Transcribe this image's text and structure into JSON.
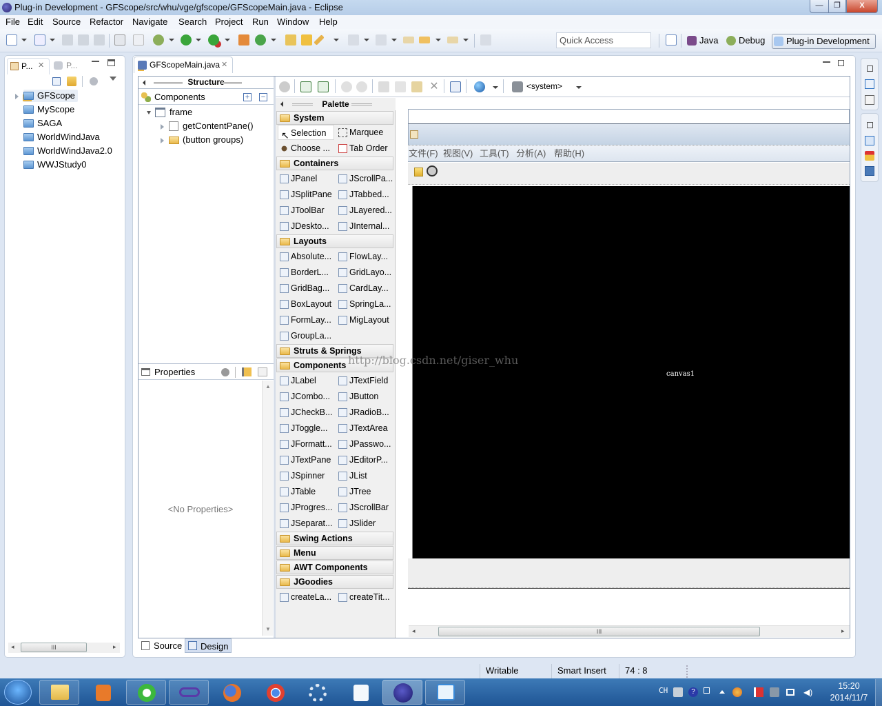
{
  "window": {
    "title": "Plug-in Development - GFScope/src/whu/vge/gfscope/GFScopeMain.java - Eclipse",
    "minimize_label": "—",
    "maximize_label": "❐",
    "close_label": "X"
  },
  "menubar": [
    "File",
    "Edit",
    "Source",
    "Refactor",
    "Navigate",
    "Search",
    "Project",
    "Run",
    "Window",
    "Help"
  ],
  "toolbar": {
    "quick_access_placeholder": "Quick Access",
    "perspectives": [
      {
        "label": "Java",
        "icon": "java-perspective-icon"
      },
      {
        "label": "Debug",
        "icon": "debug-perspective-icon"
      },
      {
        "label": "Plug-in Development",
        "icon": "plugin-perspective-icon",
        "active": true
      }
    ]
  },
  "left_panel": {
    "tabs": [
      {
        "label": "P...",
        "icon": "package-explorer-icon",
        "active": true
      },
      {
        "label": "P...",
        "icon": "plugins-icon",
        "active": false
      }
    ],
    "projects": [
      {
        "label": "GFScope",
        "selected": true
      },
      {
        "label": "MyScope"
      },
      {
        "label": "SAGA"
      },
      {
        "label": "WorldWindJava"
      },
      {
        "label": "WorldWindJava2.0"
      },
      {
        "label": "WWJStudy0"
      }
    ],
    "hscroll_thumb": "III"
  },
  "editor": {
    "tab_label": "GFScopeMain.java",
    "structure": {
      "title": "Structure",
      "components_label": "Components",
      "tree": {
        "root": "frame",
        "children": [
          "getContentPane()",
          "(button groups)"
        ]
      }
    },
    "properties": {
      "title": "Properties",
      "empty_text": "<No Properties>"
    },
    "design_toolbar": {
      "lookandfeel_label": "<system>"
    },
    "palette": {
      "title": "Palette",
      "categories": [
        {
          "name": "System",
          "open": true,
          "items": [
            "Selection",
            "Marquee",
            "Choose ...",
            "Tab Order"
          ]
        },
        {
          "name": "Containers",
          "open": false,
          "items": [
            "JPanel",
            "JScrollPa...",
            "JSplitPane",
            "JTabbed...",
            "JToolBar",
            "JLayered...",
            "JDeskto...",
            "JInternal..."
          ]
        },
        {
          "name": "Layouts",
          "open": true,
          "items": [
            "Absolute...",
            "FlowLay...",
            "BorderL...",
            "GridLayo...",
            "GridBag...",
            "CardLay...",
            "BoxLayout",
            "SpringLa...",
            "FormLay...",
            "MigLayout",
            "GroupLa..."
          ]
        },
        {
          "name": "Struts & Springs",
          "open": false,
          "items": []
        },
        {
          "name": "Components",
          "open": true,
          "items": [
            "JLabel",
            "JTextField",
            "JCombo...",
            "JButton",
            "JCheckB...",
            "JRadioB...",
            "JToggle...",
            "JTextArea",
            "JFormatt...",
            "JPasswo...",
            "JTextPane",
            "JEditorP...",
            "JSpinner",
            "JList",
            "JTable",
            "JTree",
            "JProgres...",
            "JScrollBar",
            "JSeparat...",
            "JSlider"
          ]
        },
        {
          "name": "Swing Actions",
          "open": false,
          "items": []
        },
        {
          "name": "Menu",
          "open": false,
          "items": []
        },
        {
          "name": "AWT Components",
          "open": false,
          "items": []
        },
        {
          "name": "JGoodies",
          "open": true,
          "items": [
            "createLa...",
            "createTit..."
          ]
        }
      ]
    },
    "design_frame": {
      "menu": [
        "文件(F)",
        "视图(V)",
        "工具(T)",
        "分析(A)",
        "帮助(H)"
      ],
      "canvas_label": "canvas1",
      "watermark": "http://blog.csdn.net/giser_whu",
      "hscroll_thumb": "III"
    },
    "bottom_tabs": [
      {
        "label": "Source",
        "active": false
      },
      {
        "label": "Design",
        "active": true
      }
    ]
  },
  "statusbar": {
    "writable": "Writable",
    "insert_mode": "Smart Insert",
    "position": "74 : 8"
  },
  "taskbar": {
    "apps": [
      "file-explorer",
      "media-player",
      "ie-browser",
      "visual-studio",
      "firefox",
      "chrome",
      "settings",
      "app-store",
      "eclipse",
      "notes"
    ],
    "tray": {
      "language": "CH",
      "time": "15:20",
      "date": "2014/11/7"
    }
  }
}
